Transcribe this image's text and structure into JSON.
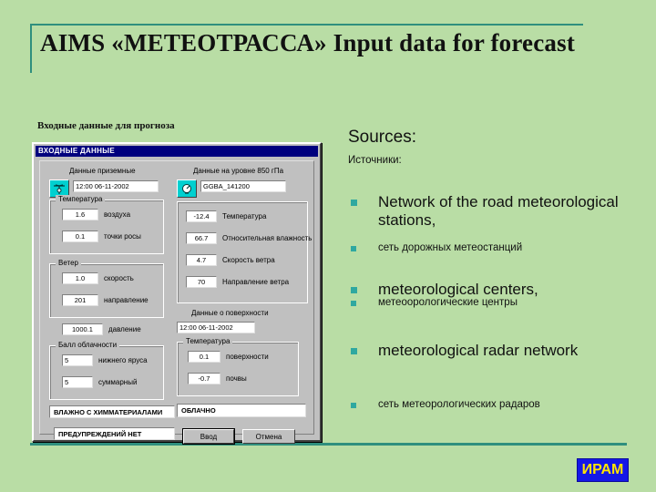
{
  "slide": {
    "title": "AIMS «МЕТЕОТРАССА» Input data for forecast",
    "subtitle": "Входные данные для прогноза",
    "logo_text": "ИРАМ",
    "accent_color": "#2f8f7e",
    "background_color": "#b9dda5",
    "bullet_color": "#2fa8a0"
  },
  "sources": {
    "heading_en": "Sources:",
    "heading_ru": "Источники:",
    "items": [
      {
        "en": "Network of the road meteorological stations,",
        "ru": "сеть дорожных метеостанций"
      },
      {
        "en": "meteorological centers,",
        "ru": "метеоорологические центры"
      },
      {
        "en": "meteorological radar network",
        "ru": "сеть метеорологических радаров"
      }
    ]
  },
  "dialog": {
    "titlebar": "ВХОДНЫЕ ДАННЫЕ",
    "left_panel": {
      "header": "Данные приземные",
      "icon": "weather-station-icon",
      "datetime_value": "12:00 06-11-2002",
      "temperature_group": {
        "label": "Температура",
        "rows": [
          {
            "value": "1.6",
            "label": "воздуха"
          },
          {
            "value": "0.1",
            "label": "точки росы"
          }
        ]
      },
      "wind_group": {
        "label": "Ветер",
        "rows": [
          {
            "value": "1.0",
            "label": "скорость"
          },
          {
            "value": "201",
            "label": "направление"
          }
        ]
      },
      "pressure": {
        "value": "1000.1",
        "label": "давление"
      },
      "cloud_group": {
        "label": "Балл облачности",
        "rows": [
          {
            "value": "5",
            "label": "нижнего яруса"
          },
          {
            "value": "5",
            "label": "суммарный"
          }
        ]
      },
      "status_1": "ВЛАЖНО С ХИММАТЕРИАЛАМИ",
      "status_2": "ПРЕДУПРЕЖДЕНИЙ НЕТ"
    },
    "right_panel": {
      "header": "Данные на уровне 850 гПа",
      "icon": "upper-air-icon",
      "file_value": "GGBA_141200",
      "rows": [
        {
          "value": "-12.4",
          "label": "Температура"
        },
        {
          "value": "66.7",
          "label": "Относительная влажность"
        },
        {
          "value": "4.7",
          "label": "Скорость ветра"
        },
        {
          "value": "70",
          "label": "Направление ветра"
        }
      ],
      "surface_header": "Данные о поверхности",
      "surface_datetime": "12:00 06-11-2002",
      "surface_temp_group": {
        "label": "Температура",
        "rows": [
          {
            "value": "0.1",
            "label": "поверхности"
          },
          {
            "value": "-0.7",
            "label": "почвы"
          }
        ]
      },
      "status": "ОБЛАЧНО"
    },
    "buttons": {
      "ok": "Ввод",
      "cancel": "Отмена"
    }
  }
}
